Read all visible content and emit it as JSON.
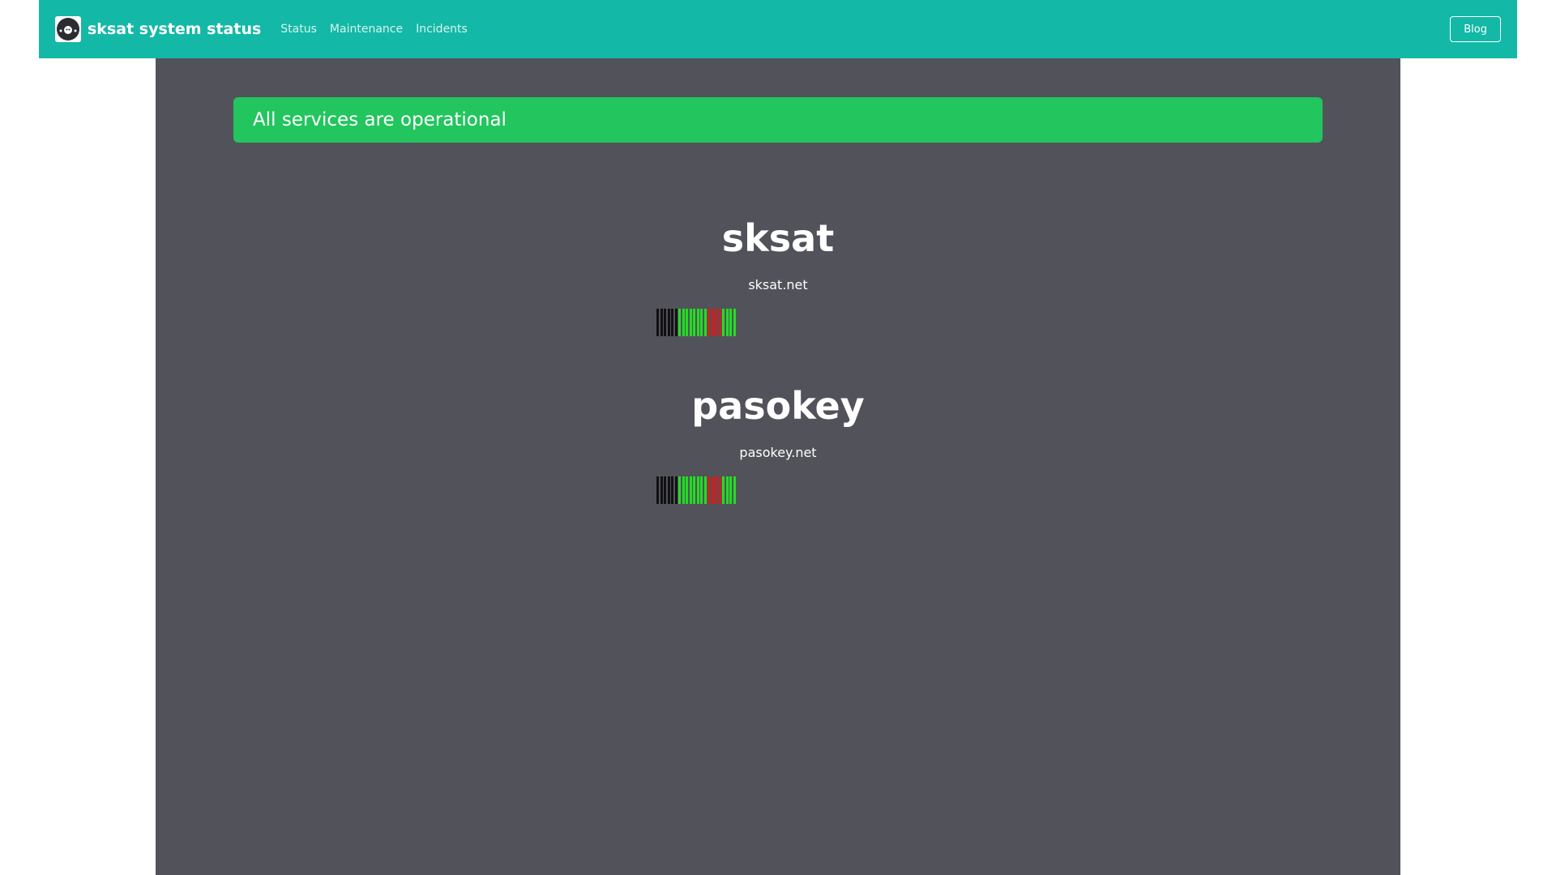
{
  "navbar": {
    "brand_title": "sksat system status",
    "logo_icon": "avatar-icon",
    "links": [
      "Status",
      "Maintenance",
      "Incidents"
    ],
    "blog_label": "Blog",
    "color": "#14b8a6"
  },
  "banner": {
    "text": "All services are operational",
    "color": "#22c55e"
  },
  "status_colors": {
    "unknown": "#111111",
    "up": "#22dd22",
    "down": "#cc1f1f"
  },
  "services": [
    {
      "name": "sksat",
      "domain": "sksat.net",
      "history": [
        "unknown",
        "unknown",
        "unknown",
        "unknown",
        "unknown",
        "unknown",
        "up",
        "up",
        "up",
        "up",
        "up",
        "up",
        "up",
        "up",
        "down",
        "down",
        "down",
        "down",
        "up",
        "up",
        "up",
        "up"
      ]
    },
    {
      "name": "pasokey",
      "domain": "pasokey.net",
      "history": [
        "unknown",
        "unknown",
        "unknown",
        "unknown",
        "unknown",
        "unknown",
        "up",
        "up",
        "up",
        "up",
        "up",
        "up",
        "up",
        "up",
        "down",
        "down",
        "down",
        "down",
        "up",
        "up",
        "up",
        "up"
      ]
    }
  ]
}
